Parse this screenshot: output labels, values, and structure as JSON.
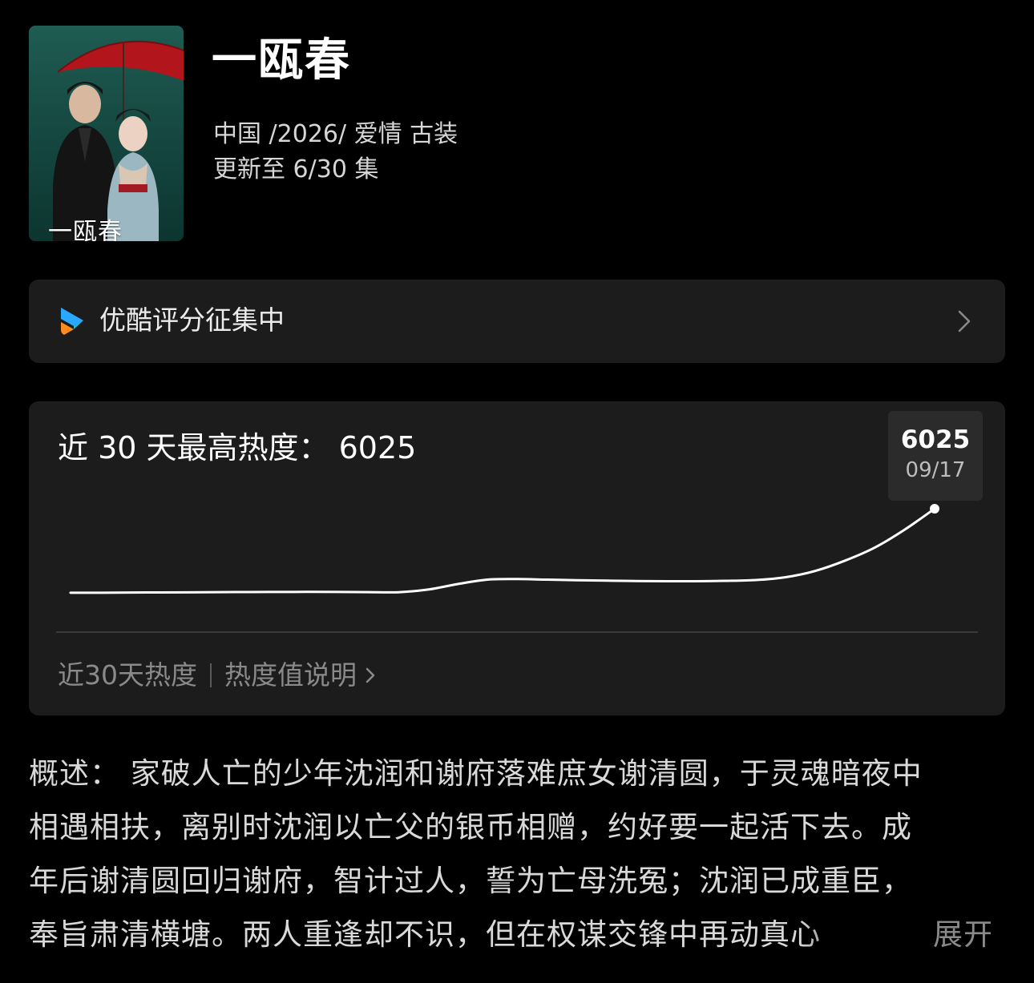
{
  "show": {
    "title": "一瓯春",
    "poster_title": "一瓯春",
    "meta_info": "中国 /2026/ 爱情  古装",
    "episodes": "更新至 6/30 集"
  },
  "rating": {
    "label": "优酷评分征集中"
  },
  "heat": {
    "title": "近 30 天最高热度：  6025",
    "peak_value": "6025",
    "peak_date": "09/17",
    "footer_label": "近30天热度",
    "explain_label": "热度值说明"
  },
  "chart_data": {
    "type": "line",
    "series": [
      {
        "values": [
          3910,
          3910,
          3915,
          3918,
          3920,
          3925,
          3928,
          3930,
          3932,
          3930,
          3925,
          3924,
          3990,
          4130,
          4240,
          4255,
          4240,
          4225,
          4215,
          4205,
          4200,
          4200,
          4210,
          4230,
          4300,
          4460,
          4720,
          5050,
          5500,
          6025
        ]
      }
    ],
    "peak": {
      "value": 6025,
      "date": "09/17"
    }
  },
  "synopsis": {
    "lines": [
      "概述：  家破人亡的少年沈润和谢府落难庶女谢清圆，于灵魂暗夜中",
      "相遇相扶，离别时沈润以亡父的银币相赠，约好要一起活下去。成",
      "年后谢清圆回归谢府，智计过人，誓为亡母洗冤；沈润已成重臣，",
      "奉旨肃清横塘。两人重逢却不识，但在权谋交锋中再动真心"
    ],
    "expand_label": "展开"
  },
  "colors": {
    "background": "#000000",
    "card": "#1c1c1c",
    "peak_box": "#2b2b2b",
    "muted_text": "#8a8a8a",
    "youku_blue": "#2aa7ff",
    "youku_orange": "#ff8a1f"
  }
}
